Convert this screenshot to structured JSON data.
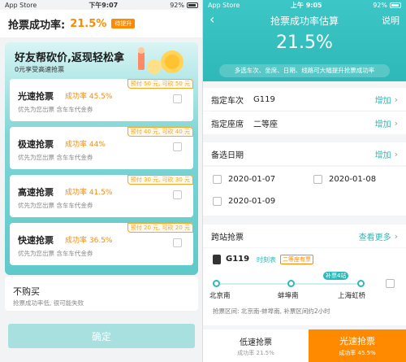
{
  "left": {
    "status": {
      "carrier": "App Store",
      "time": "下午9:07",
      "battery": "92%"
    },
    "rate_label": "抢票成功率:",
    "rate_value": "21.5%",
    "rate_tag": "待提升",
    "promo_title": "好友帮砍价,返现轻松拿",
    "promo_sub": "0元享受高速抢票",
    "options": [
      {
        "name": "光速抢票",
        "rate": "成功率 45.5%",
        "desc": "优先为您出票  含车车代金券",
        "tag": "预付 50 元, 可砍 50 元"
      },
      {
        "name": "极速抢票",
        "rate": "成功率 44%",
        "desc": "优先为您出票  含车车代金券",
        "tag": "预付 40 元, 可砍 40 元"
      },
      {
        "name": "高速抢票",
        "rate": "成功率 41.5%",
        "desc": "优先为您出票  含车车代金券",
        "tag": "预付 30 元, 可砍 30 元"
      },
      {
        "name": "快速抢票",
        "rate": "成功率 36.5%",
        "desc": "优先为您出票  含车车代金券",
        "tag": "预付 20 元, 可砍 20 元"
      }
    ],
    "nobuy_name": "不购买",
    "nobuy_desc": "抢票成功率低, 很可能失败",
    "confirm_label": "确定"
  },
  "right": {
    "status": {
      "carrier": "App Store",
      "time": "上午 9:05",
      "battery": "92%"
    },
    "title": "抢票成功率估算",
    "help": "说明",
    "rate": "21.5%",
    "note": "多选车次、坐席、日期、线路可大幅提升抢票成功率",
    "train_label": "指定车次",
    "train_value": "G119",
    "add_label": "增加",
    "seat_label": "指定座席",
    "seat_value": "二等座",
    "date_label": "备选日期",
    "dates": [
      "2020-01-07",
      "2020-01-08",
      "2020-01-09"
    ],
    "ks_label": "跨站抢票",
    "ks_more": "查看更多",
    "ks_train": "G119",
    "ks_timetable": "时刻表",
    "ks_seat": "二等座有票",
    "ks_jump": "补票4站",
    "stations": [
      "北京南",
      "蚌埠南",
      "上海虹桥"
    ],
    "range_text": "抢票区间: 北京南-蚌埠南, 补票区间约2小时",
    "low_label": "低速抢票",
    "low_sub": "成功率 21.5%",
    "fast_label": "光速抢票",
    "fast_sub": "成功率 45.5%"
  }
}
